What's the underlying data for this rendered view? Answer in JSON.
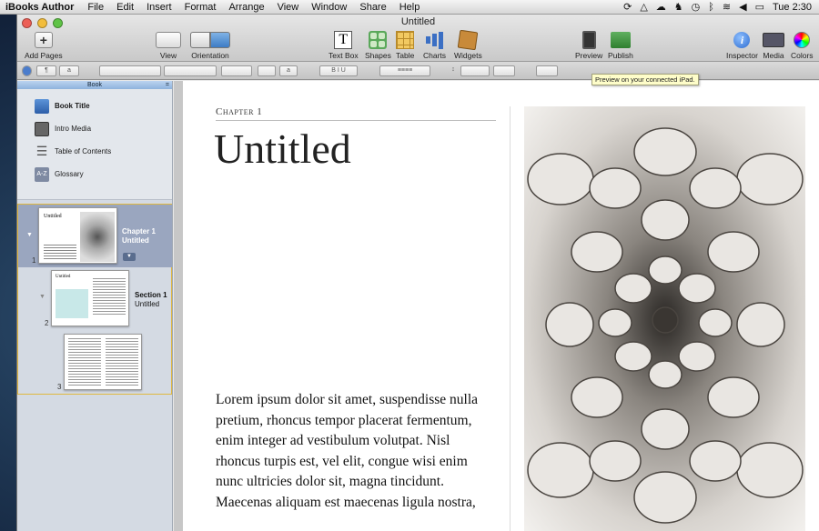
{
  "menubar": {
    "app_name": "iBooks Author",
    "items": [
      "File",
      "Edit",
      "Insert",
      "Format",
      "Arrange",
      "View",
      "Window",
      "Share",
      "Help"
    ],
    "clock": "Tue 2:30"
  },
  "window": {
    "title": "Untitled"
  },
  "toolbar": {
    "add_pages": "Add Pages",
    "view": "View",
    "orientation": "Orientation",
    "text_box": "Text Box",
    "shapes": "Shapes",
    "table": "Table",
    "charts": "Charts",
    "widgets": "Widgets",
    "preview": "Preview",
    "publish": "Publish",
    "inspector": "Inspector",
    "media": "Media",
    "colors": "Colors"
  },
  "tooltip": "Preview on your connected iPad.",
  "sidebar": {
    "header": "Book",
    "items": [
      {
        "label": "Book Title",
        "icon": "book-icon"
      },
      {
        "label": "Intro Media",
        "icon": "film-icon"
      },
      {
        "label": "Table of Contents",
        "icon": "list-icon"
      },
      {
        "label": "Glossary",
        "icon": "glossary-icon",
        "icon_text": "A-Z"
      }
    ],
    "thumbnails": [
      {
        "number": "1",
        "line1": "Chapter 1",
        "line2": "Untitled"
      },
      {
        "number": "2",
        "line1": "Section 1",
        "line2": "Untitled"
      },
      {
        "number": "3"
      }
    ]
  },
  "page": {
    "chapter_label": "Chapter 1",
    "title": "Untitled",
    "body": "Lorem ipsum dolor sit amet, suspendisse nulla pretium, rhoncus tempor placerat fermentum, enim integer ad vestibulum volutpat. Nisl rhoncus turpis est, vel elit, congue wisi enim nunc ultricies dolor sit, magna tincidunt. Maecenas aliquam est maecenas ligula nostra,"
  }
}
